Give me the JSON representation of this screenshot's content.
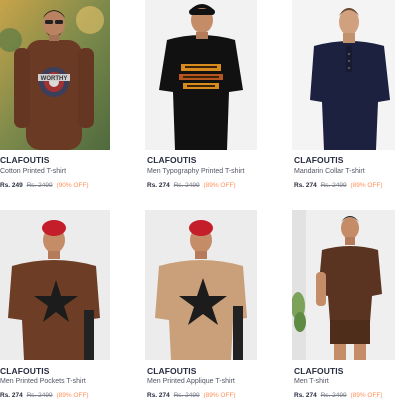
{
  "products": [
    {
      "brand": "CLAFOUTIS",
      "title": "Cotton Printed T-shirt",
      "price": "Rs. 249",
      "mrp": "Rs. 2499",
      "discount": "(90% OFF)",
      "image": "model-brown-tshirt-shield-print"
    },
    {
      "brand": "CLAFOUTIS",
      "title": "Men Typography Printed T-shirt",
      "price": "Rs. 274",
      "mrp": "Rs. 2499",
      "discount": "(89% OFF)",
      "image": "model-black-tshirt-typography"
    },
    {
      "brand": "CLAFOUTIS",
      "title": "Mandarin Collar T-shirt",
      "price": "Rs. 274",
      "mrp": "Rs. 2499",
      "discount": "(89% OFF)",
      "image": "model-navy-henley-tshirt"
    },
    {
      "brand": "CLAFOUTIS",
      "title": "Men Printed Pockets T-shirt",
      "price": "Rs. 274",
      "mrp": "Rs. 2499",
      "discount": "(89% OFF)",
      "image": "model-brown-star-tshirt"
    },
    {
      "brand": "CLAFOUTIS",
      "title": "Men Printed Applique T-shirt",
      "price": "Rs. 274",
      "mrp": "Rs. 2499",
      "discount": "(89% OFF)",
      "image": "model-beige-star-tshirt"
    },
    {
      "brand": "CLAFOUTIS",
      "title": "Men T-shirt",
      "price": "Rs. 274",
      "mrp": "Rs. 2499",
      "discount": "(89% OFF)",
      "image": "model-brown-tshirt-shorts"
    }
  ],
  "colors": {
    "brand_text": "#282c3f",
    "title_text": "#535766",
    "mrp_text": "#7e818c",
    "discount_text": "#ff905a"
  }
}
